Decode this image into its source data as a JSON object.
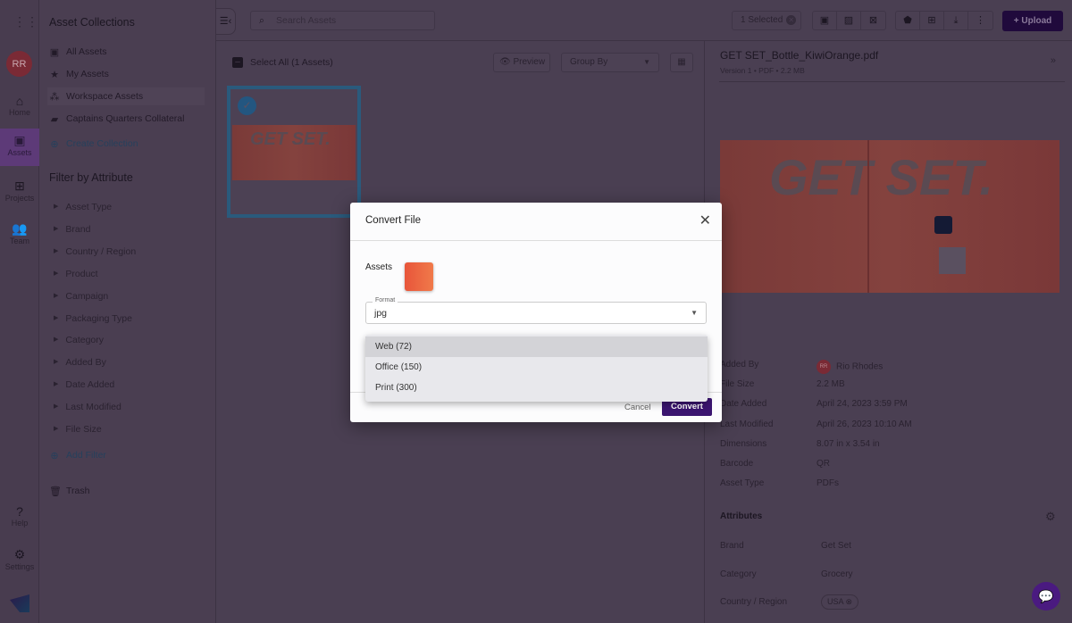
{
  "rail": {
    "avatar": "RR",
    "nav": [
      {
        "label": "Home",
        "icon": "home-icon"
      },
      {
        "label": "Assets",
        "icon": "assets-icon",
        "active": true
      },
      {
        "label": "Projects",
        "icon": "projects-icon"
      },
      {
        "label": "Team",
        "icon": "team-icon"
      }
    ],
    "help": "Help",
    "settings": "Settings"
  },
  "sidebar": {
    "collections_title": "Asset Collections",
    "collections": [
      "All Assets",
      "My Assets",
      "Workspace Assets",
      "Captains Quarters Collateral"
    ],
    "create_collection": "Create Collection",
    "filter_title": "Filter by Attribute",
    "filters": [
      "Asset Type",
      "Brand",
      "Country / Region",
      "Product",
      "Campaign",
      "Packaging Type",
      "Category",
      "Added By",
      "Date Added",
      "Last Modified",
      "File Size"
    ],
    "add_filter": "Add Filter",
    "trash": "Trash"
  },
  "topbar": {
    "search_placeholder": "Search Assets",
    "selected": "1 Selected",
    "upload": "Upload"
  },
  "main": {
    "select_all": "Select All (1 Assets)",
    "preview": "Preview",
    "group_by": "Group By",
    "asset_art_text": "GET SET."
  },
  "details": {
    "filename": "GET SET_Bottle_KiwiOrange.pdf",
    "version": "Version 1",
    "type": "PDF",
    "size": "2.2 MB",
    "fields": [
      {
        "label": "Added By",
        "value": "Rio Rhodes",
        "avatar": "RR"
      },
      {
        "label": "File Size",
        "value": "2.2 MB"
      },
      {
        "label": "Date Added",
        "value": "April 24, 2023 3:59 PM"
      },
      {
        "label": "Last Modified",
        "value": "April 26, 2023 10:10 AM"
      },
      {
        "label": "Dimensions",
        "value": "8.07 in x 3.54 in"
      },
      {
        "label": "Barcode",
        "value": "QR"
      },
      {
        "label": "Asset Type",
        "value": "PDFs"
      }
    ],
    "attributes_title": "Attributes",
    "attributes": [
      {
        "label": "Brand",
        "value": "Get Set"
      },
      {
        "label": "Category",
        "value": "Grocery"
      },
      {
        "label": "Country / Region",
        "value": "USA"
      }
    ]
  },
  "modal": {
    "title": "Convert File",
    "assets_label": "Assets",
    "format_label": "Format",
    "format_value": "jpg",
    "options": [
      "Web (72)",
      "Office (150)",
      "Print (300)"
    ],
    "cancel": "Cancel",
    "convert": "Convert"
  },
  "colors": {
    "accent": "#3b1570",
    "selection": "#3c9ad6",
    "avatar": "#cc3333"
  }
}
